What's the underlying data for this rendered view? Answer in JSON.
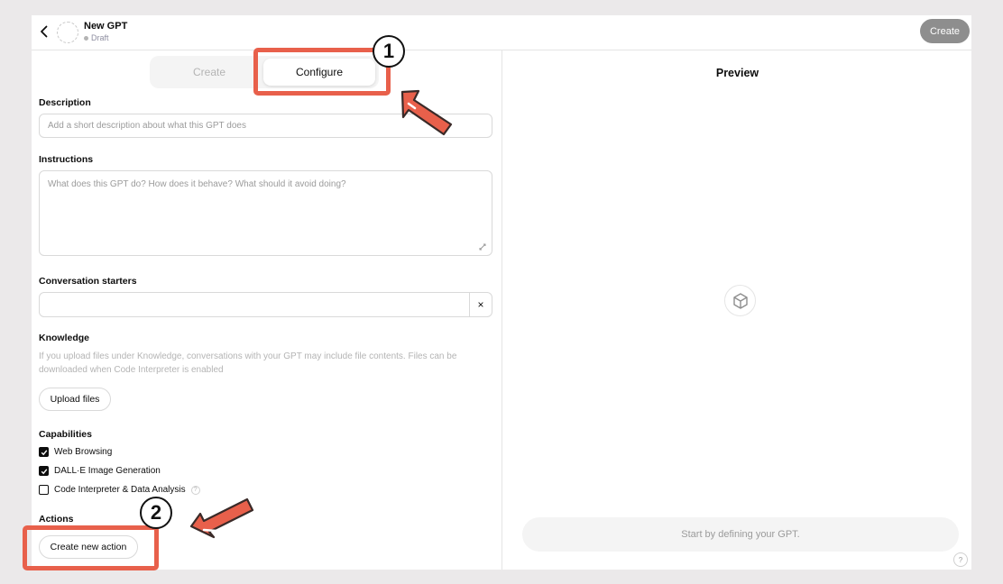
{
  "header": {
    "gpt_name": "New GPT",
    "gpt_status": "Draft",
    "create_button": "Create"
  },
  "tabs": [
    {
      "label": "Create"
    },
    {
      "label": "Configure"
    }
  ],
  "form": {
    "description_label": "Description",
    "description_placeholder": "Add a short description about what this GPT does",
    "instructions_label": "Instructions",
    "instructions_placeholder": "What does this GPT do? How does it behave? What should it avoid doing?",
    "starters_label": "Conversation starters",
    "starters_clear": "×",
    "knowledge_label": "Knowledge",
    "knowledge_help": "If you upload files under Knowledge, conversations with your GPT may include file contents. Files can be downloaded when Code Interpreter is enabled",
    "upload_button": "Upload files",
    "capabilities_label": "Capabilities",
    "capabilities": [
      {
        "label": "Web Browsing",
        "checked": true
      },
      {
        "label": "DALL·E Image Generation",
        "checked": true
      },
      {
        "label": "Code Interpreter & Data Analysis",
        "checked": false
      }
    ],
    "actions_label": "Actions",
    "create_action_button": "Create new action"
  },
  "preview": {
    "title": "Preview",
    "input_placeholder": "Start by defining your GPT.",
    "help": "?"
  },
  "annotations": {
    "step1": "1",
    "step2": "2",
    "color": "#e8604b"
  }
}
